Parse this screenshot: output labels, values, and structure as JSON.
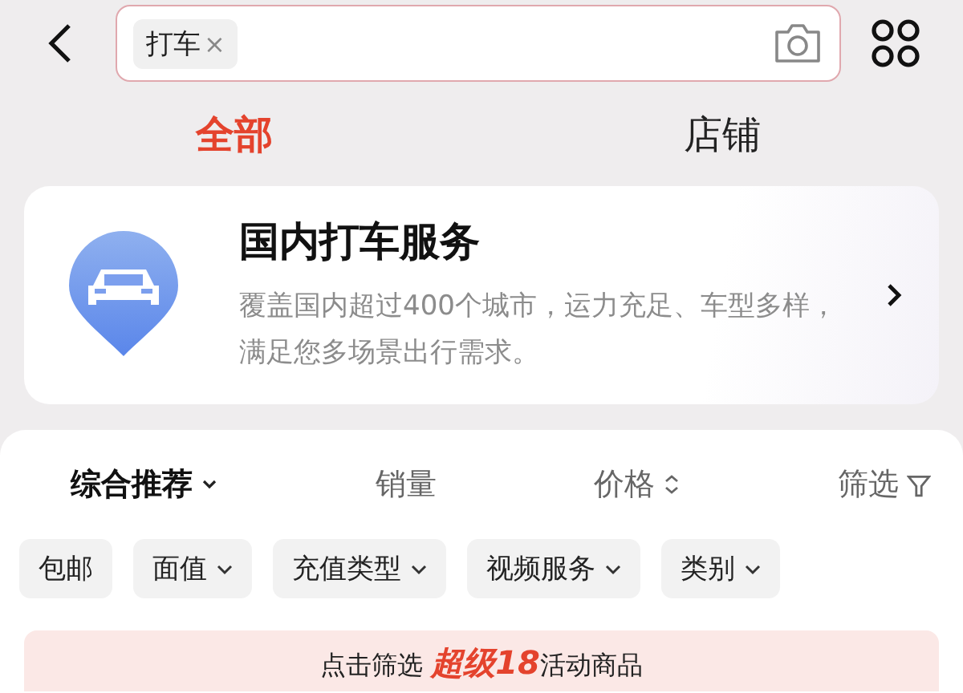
{
  "search": {
    "tag": "打车",
    "tag_remove": "×"
  },
  "tabs": [
    {
      "label": "全部",
      "selected": true
    },
    {
      "label": "店铺",
      "selected": false
    }
  ],
  "service_card": {
    "title": "国内打车服务",
    "description": "覆盖国内超过400个城市，运力充足、车型多样，满足您多场景出行需求。"
  },
  "sort_options": [
    {
      "label": "综合推荐",
      "kind": "dropdown",
      "selected": true
    },
    {
      "label": "销量",
      "kind": "plain",
      "selected": false
    },
    {
      "label": "价格",
      "kind": "sort",
      "selected": false
    },
    {
      "label": "筛选",
      "kind": "filter",
      "selected": false
    }
  ],
  "filter_chips": [
    {
      "label": "包邮",
      "dropdown": false
    },
    {
      "label": "面值",
      "dropdown": true
    },
    {
      "label": "充值类型",
      "dropdown": true
    },
    {
      "label": "视频服务",
      "dropdown": true
    },
    {
      "label": "类别",
      "dropdown": true
    }
  ],
  "promo_banner": {
    "prefix": "点击筛选 ",
    "highlight": "超级18",
    "suffix": "活动商品"
  }
}
